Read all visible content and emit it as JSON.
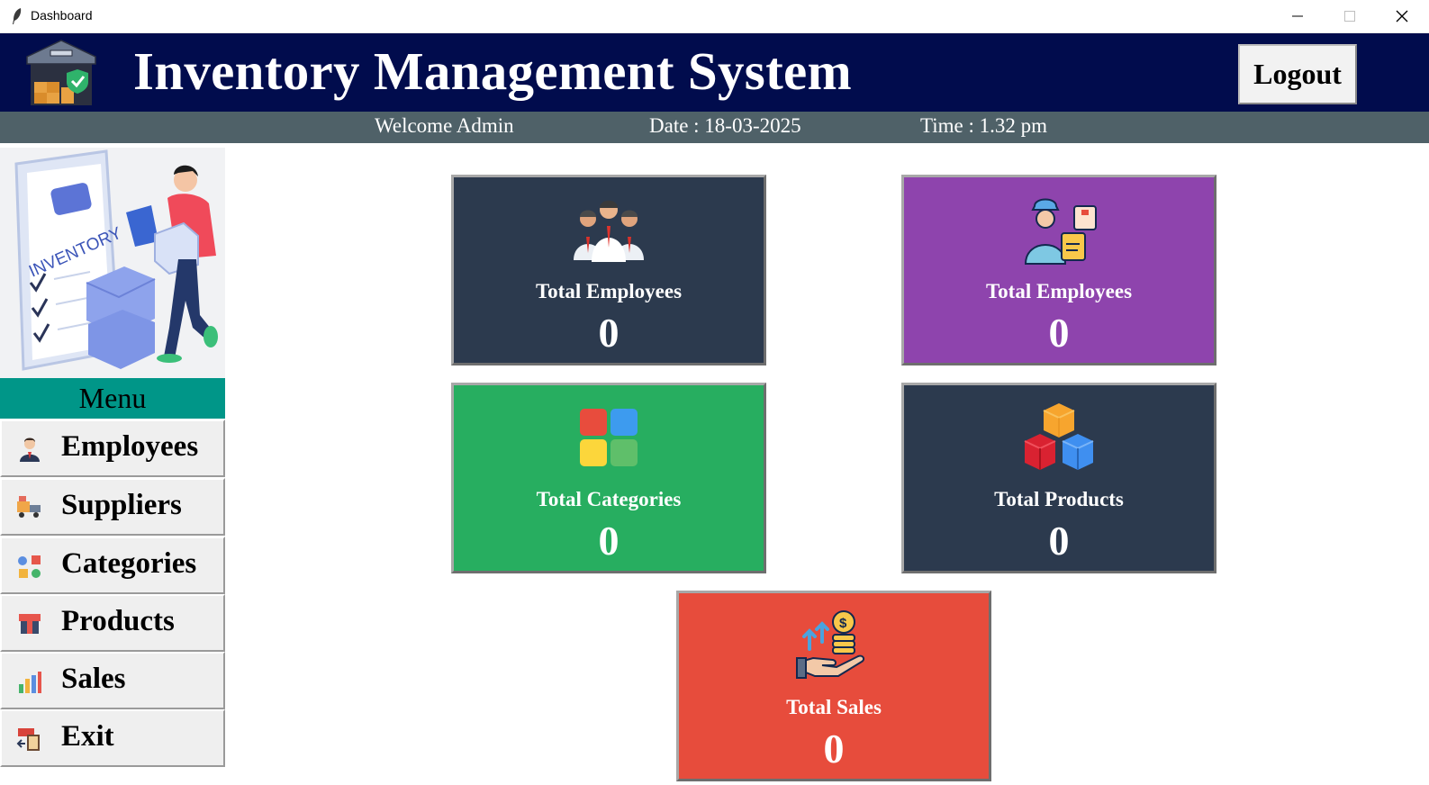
{
  "window": {
    "title": "Dashboard"
  },
  "header": {
    "title": "Inventory Management System",
    "logout_label": "Logout",
    "background": "#010c4d"
  },
  "subbar": {
    "welcome": "Welcome Admin",
    "date": "Date : 18-03-2025",
    "time": "Time : 1.32 pm",
    "background": "#4f6168"
  },
  "sidebar": {
    "image_text": "INVENTORY",
    "menu_title": "Menu",
    "menu_color": "#009688",
    "items": [
      {
        "label": "Employees",
        "icon": "employee-icon"
      },
      {
        "label": "Suppliers",
        "icon": "supplier-icon"
      },
      {
        "label": "Categories",
        "icon": "categories-icon"
      },
      {
        "label": "Products",
        "icon": "products-icon"
      },
      {
        "label": "Sales",
        "icon": "sales-icon"
      },
      {
        "label": "Exit",
        "icon": "exit-icon"
      }
    ]
  },
  "cards": [
    {
      "label": "Total Employees",
      "value": "0",
      "color": "#2c3a4e",
      "icon": "employees-group-icon"
    },
    {
      "label": "Total Employees",
      "value": "0",
      "color": "#8e44ad",
      "icon": "supplier-delivery-icon"
    },
    {
      "label": "Total Categories",
      "value": "0",
      "color": "#27ae60",
      "icon": "category-grid-icon"
    },
    {
      "label": "Total Products",
      "value": "0",
      "color": "#2c3a4e",
      "icon": "product-cubes-icon"
    },
    {
      "label": "Total Sales",
      "value": "0",
      "color": "#e74c3c",
      "icon": "sales-coins-icon"
    }
  ]
}
